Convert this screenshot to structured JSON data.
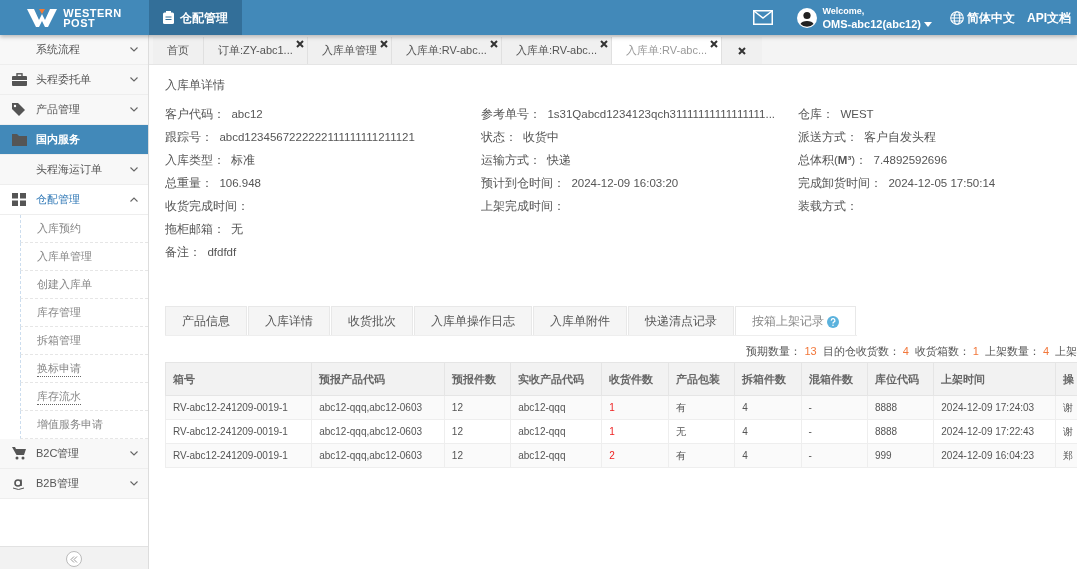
{
  "header": {
    "logo_line1": "WESTERN",
    "logo_line2": "POST",
    "module": "仓配管理",
    "welcome": "Welcome,",
    "user": "OMS-abc12(abc12)",
    "language": "简体中文",
    "api_docs": "API文档"
  },
  "sidebar": {
    "items": [
      {
        "label": "系统流程",
        "kind": "plain",
        "selected": false,
        "expanded": false
      },
      {
        "label": "头程委托单",
        "kind": "briefcase",
        "selected": false,
        "expanded": false
      },
      {
        "label": "产品管理",
        "kind": "tag",
        "selected": false,
        "expanded": false
      },
      {
        "label": "国内服务",
        "kind": "folder",
        "selected": true,
        "expanded": false
      },
      {
        "label": "头程海运订单",
        "kind": "plain",
        "selected": false,
        "expanded": false
      },
      {
        "label": "仓配管理",
        "kind": "grid",
        "selected": false,
        "expanded": true,
        "children": [
          {
            "label": "入库预约",
            "underlined": false
          },
          {
            "label": "入库单管理",
            "underlined": false
          },
          {
            "label": "创建入库单",
            "underlined": false
          },
          {
            "label": "库存管理",
            "underlined": false
          },
          {
            "label": "拆箱管理",
            "underlined": false
          },
          {
            "label": "换标申请",
            "underlined": true
          },
          {
            "label": "库存流水",
            "underlined": true
          },
          {
            "label": "增值服务申请",
            "underlined": false
          }
        ]
      },
      {
        "label": "B2C管理",
        "kind": "cart",
        "selected": false,
        "expanded": false
      },
      {
        "label": "B2B管理",
        "kind": "amazon",
        "selected": false,
        "expanded": false
      }
    ]
  },
  "tabs": [
    {
      "label": "首页",
      "selected": false,
      "closable": false
    },
    {
      "label": "订单:ZY-abc1...",
      "selected": false,
      "closable": true
    },
    {
      "label": "入库单管理",
      "selected": false,
      "closable": true
    },
    {
      "label": "入库单:RV-abc...",
      "selected": false,
      "closable": true
    },
    {
      "label": "入库单:RV-abc...",
      "selected": false,
      "closable": true
    },
    {
      "label": "入库单:RV-abc...",
      "selected": true,
      "closable": true
    }
  ],
  "detail": {
    "title": "入库单详情",
    "columns": [
      [
        {
          "label": "客户代码：",
          "value": "abc12"
        },
        {
          "label": "跟踪号：",
          "value": "abcd1234567222222111111111211121"
        },
        {
          "label": "入库类型：",
          "value": "标准"
        },
        {
          "label": "总重量：",
          "value": "106.948"
        },
        {
          "label": "收货完成时间："
        },
        {
          "label": "拖柜邮箱：",
          "value": "无"
        },
        {
          "label": "备注：",
          "value": "dfdfdf"
        }
      ],
      [
        {
          "label": "参考单号：",
          "value": "1s31Qabcd1234123qch31111111111111111..."
        },
        {
          "label": "状态：",
          "value": "收货中"
        },
        {
          "label": "运输方式：",
          "value": "快递"
        },
        {
          "label": "预计到仓时间：",
          "value": "2024-12-09 16:03:20"
        },
        {
          "label": "上架完成时间："
        }
      ],
      [
        {
          "label": "仓库：",
          "value": "WEST"
        },
        {
          "label": "派送方式：",
          "value": "客户自发头程"
        },
        {
          "label": "总体积(**M³**)：",
          "value": "7.4892592696"
        },
        {
          "label": "完成卸货时间：",
          "value": "2024-12-05 17:50:14"
        },
        {
          "label": "装载方式："
        }
      ]
    ]
  },
  "subtabs": [
    {
      "label": "产品信息",
      "selected": false,
      "help": false
    },
    {
      "label": "入库详情",
      "selected": false,
      "help": false
    },
    {
      "label": "收货批次",
      "selected": false,
      "help": false
    },
    {
      "label": "入库单操作日志",
      "selected": false,
      "help": false
    },
    {
      "label": "入库单附件",
      "selected": false,
      "help": false
    },
    {
      "label": "快递清点记录",
      "selected": false,
      "help": false
    },
    {
      "label": "按箱上架记录",
      "selected": true,
      "help": true
    }
  ],
  "summary": [
    {
      "label": "预期数量：",
      "value": "13"
    },
    {
      "label": "目的仓收货数：",
      "value": "4"
    },
    {
      "label": "收货箱数：",
      "value": "1"
    },
    {
      "label": "上架数量：",
      "value": "4"
    },
    {
      "label": "上架"
    }
  ],
  "table": {
    "columns": [
      "箱号",
      "预报产品代码",
      "预报件数",
      "实收产品代码",
      "收货件数",
      "产品包装",
      "拆箱件数",
      "混箱件数",
      "库位代码",
      "上架时间",
      "操"
    ],
    "rows": [
      [
        "RV-abc12-241209-0019-1",
        "abc12-qqq,abc12-0603",
        "12",
        "abc12-qqq",
        "1",
        "有",
        "4",
        "-",
        "8888",
        "2024-12-09 17:24:03",
        "谢"
      ],
      [
        "RV-abc12-241209-0019-1",
        "abc12-qqq,abc12-0603",
        "12",
        "abc12-qqq",
        "1",
        "无",
        "4",
        "-",
        "8888",
        "2024-12-09 17:22:43",
        "谢"
      ],
      [
        "RV-abc12-241209-0019-1",
        "abc12-qqq,abc12-0603",
        "12",
        "abc12-qqq",
        "2",
        "有",
        "4",
        "-",
        "999",
        "2024-12-09 16:04:23",
        "郑"
      ]
    ]
  }
}
